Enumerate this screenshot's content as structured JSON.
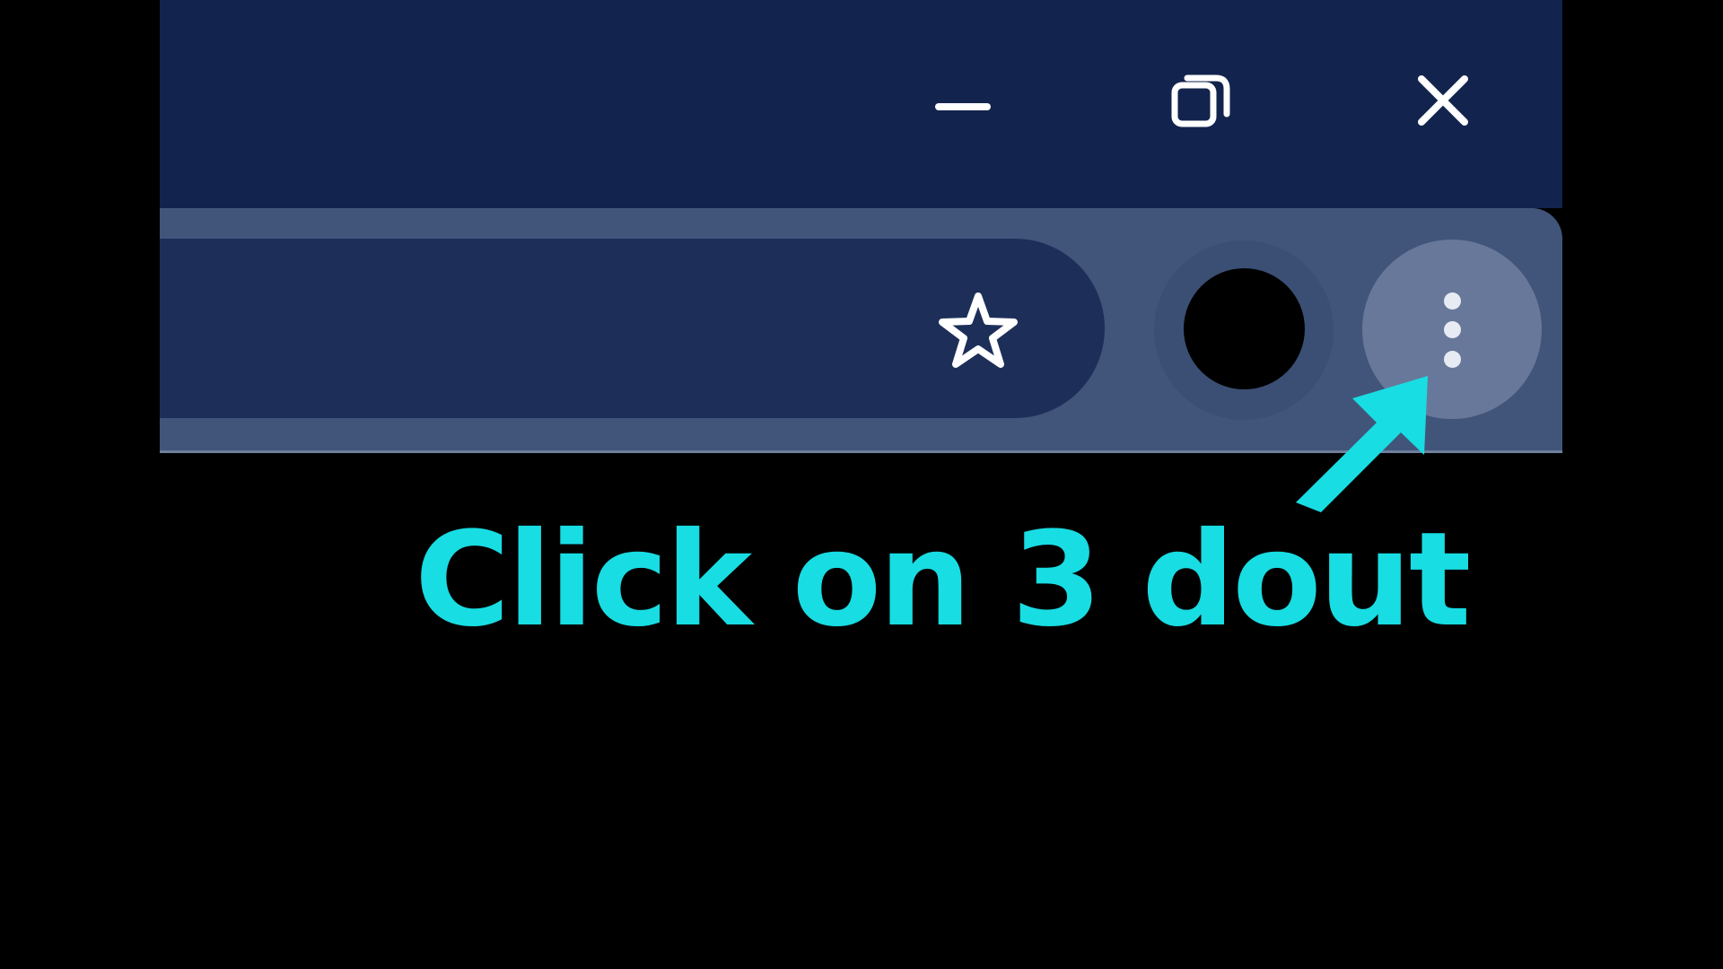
{
  "browser": {
    "window_controls": {
      "minimize_icon": "minimize-icon",
      "restore_icon": "restore-icon",
      "close_icon": "close-icon"
    },
    "toolbar": {
      "bookmark_icon": "star-icon",
      "profile_icon": "avatar-icon",
      "menu_icon": "three-dots-vertical-icon"
    }
  },
  "annotation": {
    "caption": "Click on 3 dout",
    "arrow_icon": "arrow-up-right-icon",
    "accent_color": "#18dde3"
  },
  "colors": {
    "titlebar": "#12244d",
    "toolbar": "#41557a",
    "omnibox": "#1d2f59",
    "menu_button": "#68789a",
    "background": "#000000"
  }
}
